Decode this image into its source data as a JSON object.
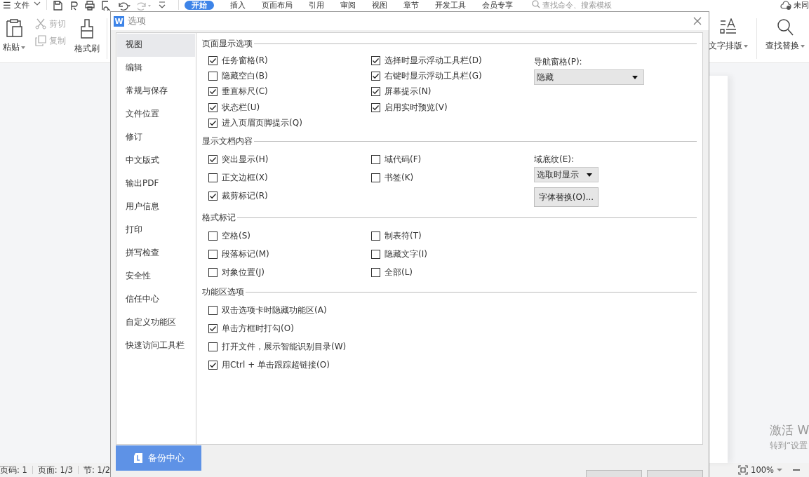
{
  "app": {
    "menu_bar": {
      "menu_icon": "☰",
      "file_menu": "文件",
      "tabs": [
        {
          "label": "开始",
          "selected": true
        },
        {
          "label": "插入",
          "selected": false
        },
        {
          "label": "页面布局",
          "selected": false
        },
        {
          "label": "引用",
          "selected": false
        },
        {
          "label": "审阅",
          "selected": false
        },
        {
          "label": "视图",
          "selected": false
        },
        {
          "label": "章节",
          "selected": false
        },
        {
          "label": "开发工具",
          "selected": false
        },
        {
          "label": "会员专享",
          "selected": false
        }
      ],
      "search": {
        "placeholder": "查找命令、搜索模板"
      },
      "account": "未同"
    },
    "ribbon_left": [
      {
        "kind": "paste",
        "label": "粘贴",
        "disabled": false
      },
      {
        "kind": "cut",
        "label": "剪切",
        "disabled": true
      },
      {
        "kind": "copy",
        "label": "复制",
        "disabled": true
      },
      {
        "kind": "brush",
        "label": "格式刷",
        "disabled": false
      }
    ],
    "ribbon_right": [
      {
        "kind": "layout",
        "label": "文字排版"
      },
      {
        "kind": "find",
        "label": "查找替换"
      }
    ],
    "activation": [
      "激活 W",
      "转到“设置"
    ],
    "status_bar": {
      "items": [
        "页码: 1",
        "页面: 1/3",
        "节: 1/2"
      ],
      "zoom": "100%"
    }
  },
  "dialog": {
    "logo": "W",
    "title": "选项",
    "sidebar": [
      {
        "label": "视图",
        "selected": true
      },
      {
        "label": "编辑",
        "selected": false
      },
      {
        "label": "常规与保存",
        "selected": false
      },
      {
        "label": "文件位置",
        "selected": false
      },
      {
        "label": "修订",
        "selected": false
      },
      {
        "label": "中文版式",
        "selected": false
      },
      {
        "label": "输出PDF",
        "selected": false
      },
      {
        "label": "用户信息",
        "selected": false
      },
      {
        "label": "打印",
        "selected": false
      },
      {
        "label": "拼写检查",
        "selected": false
      },
      {
        "label": "安全性",
        "selected": false
      },
      {
        "label": "信任中心",
        "selected": false
      },
      {
        "label": "自定义功能区",
        "selected": false
      },
      {
        "label": "快速访问工具栏",
        "selected": false
      }
    ],
    "backup_button": "备份中心",
    "sections": [
      {
        "title": "页面显示选项",
        "columns": [
          [
            {
              "kind": "checkbox",
              "label": "任务窗格(R)",
              "checked": true
            },
            {
              "kind": "checkbox",
              "label": "隐藏空白(B)",
              "checked": false
            },
            {
              "kind": "checkbox",
              "label": "垂直标尺(C)",
              "checked": true
            },
            {
              "kind": "checkbox",
              "label": "状态栏(U)",
              "checked": true
            },
            {
              "kind": "checkbox",
              "label": "进入页眉页脚提示(Q)",
              "checked": true
            }
          ],
          [
            {
              "kind": "checkbox",
              "label": "选择时显示浮动工具栏(D)",
              "checked": true
            },
            {
              "kind": "checkbox",
              "label": "右键时显示浮动工具栏(G)",
              "checked": true
            },
            {
              "kind": "checkbox",
              "label": "屏幕提示(N)",
              "checked": true
            },
            {
              "kind": "checkbox",
              "label": "启用实时预览(V)",
              "checked": true
            }
          ],
          [
            {
              "kind": "label",
              "label": "导航窗格(P):"
            },
            {
              "kind": "dropdown",
              "label": "隐藏"
            }
          ]
        ]
      },
      {
        "title": "显示文档内容",
        "columns": [
          [
            {
              "kind": "checkbox",
              "label": "突出显示(H)",
              "checked": true
            },
            {
              "kind": "checkbox",
              "label": "正文边框(X)",
              "checked": false
            },
            {
              "kind": "checkbox",
              "label": "裁剪标记(R)",
              "checked": true
            }
          ],
          [
            {
              "kind": "checkbox",
              "label": "域代码(F)",
              "checked": false
            },
            {
              "kind": "checkbox",
              "label": "书签(K)",
              "checked": false
            }
          ],
          [
            {
              "kind": "label",
              "label": "域底纹(E):"
            },
            {
              "kind": "dropdown",
              "label": "选取时显示"
            },
            {
              "kind": "button",
              "label": "字体替换(O)..."
            }
          ]
        ]
      },
      {
        "title": "格式标记",
        "columns": [
          [
            {
              "kind": "checkbox",
              "label": "空格(S)",
              "checked": false
            },
            {
              "kind": "checkbox",
              "label": "段落标记(M)",
              "checked": false
            },
            {
              "kind": "checkbox",
              "label": "对象位置(J)",
              "checked": false
            }
          ],
          [
            {
              "kind": "checkbox",
              "label": "制表符(T)",
              "checked": false
            },
            {
              "kind": "checkbox",
              "label": "隐藏文字(I)",
              "checked": false
            },
            {
              "kind": "checkbox",
              "label": "全部(L)",
              "checked": false
            }
          ]
        ]
      },
      {
        "title": "功能区选项",
        "columns": [
          [
            {
              "kind": "checkbox",
              "label": "双击选项卡时隐藏功能区(A)",
              "checked": false
            },
            {
              "kind": "checkbox",
              "label": "单击方框时打勾(O)",
              "checked": true
            },
            {
              "kind": "checkbox",
              "label": "打开文件，展示智能识别目录(W)",
              "checked": false
            },
            {
              "kind": "checkbox",
              "label": "用Ctrl + 单击跟踪超链接(O)",
              "checked": true
            }
          ]
        ]
      }
    ]
  }
}
